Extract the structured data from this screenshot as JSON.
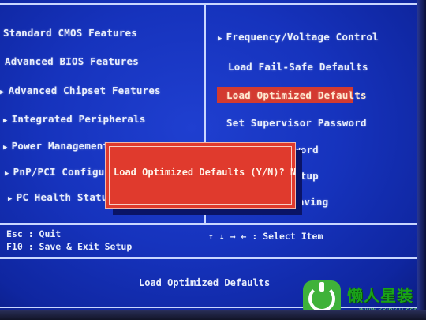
{
  "left_menu": [
    {
      "label": "Standard CMOS Features",
      "arrow": false
    },
    {
      "label": "Advanced BIOS Features",
      "arrow": false
    },
    {
      "label": "Advanced Chipset Features",
      "arrow": true
    },
    {
      "label": "Integrated Peripherals",
      "arrow": true
    },
    {
      "label": "Power Management",
      "arrow": true
    },
    {
      "label": "PnP/PCI Configura",
      "arrow": true
    },
    {
      "label": "PC Health Status",
      "arrow": true
    }
  ],
  "right_menu": [
    {
      "label": "Frequency/Voltage Control",
      "arrow": true
    },
    {
      "label": "Load Fail-Safe Defaults",
      "arrow": false
    },
    {
      "label": "Load Optimized Defaults",
      "arrow": false,
      "selected": true
    },
    {
      "label": "Set Supervisor Password",
      "arrow": false
    },
    {
      "label": "word",
      "arrow": false
    },
    {
      "label": "etup",
      "arrow": false
    },
    {
      "label": "Saving",
      "arrow": false
    }
  ],
  "arrow_glyph": "▶",
  "status": {
    "esc": "Esc : Quit",
    "f10": "F10 : Save & Exit Setup",
    "nav": "↑ ↓ → ←  : Select Item"
  },
  "dialog": {
    "text": "Load Optimized Defaults (Y/N)? N"
  },
  "footer": {
    "message": "Load Optimized Defaults"
  },
  "watermark": {
    "text": "懒人星装",
    "url": "www.kxinyiu.com",
    "icon": "power-icon"
  },
  "colors": {
    "background": "#1633bd",
    "highlight": "#d33a30",
    "dialog": "#e03a2d",
    "text": "#e8eefc"
  }
}
